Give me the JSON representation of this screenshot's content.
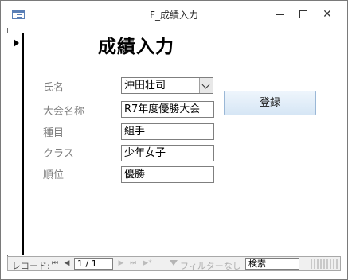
{
  "window": {
    "title": "F_成績入力",
    "minimize_glyph": "",
    "close_glyph": "✕"
  },
  "form": {
    "title": "成績入力",
    "fields": [
      {
        "label": "氏名",
        "value": "沖田壮司",
        "type": "combo"
      },
      {
        "label": "大会名称",
        "value": "R7年度優勝大会",
        "type": "text"
      },
      {
        "label": "種目",
        "value": "組手",
        "type": "text"
      },
      {
        "label": "クラス",
        "value": "少年女子",
        "type": "text"
      },
      {
        "label": "順位",
        "value": "優勝",
        "type": "text"
      }
    ],
    "register_button": "登録"
  },
  "navbar": {
    "record_label": "レコード:",
    "first_glyph": "⏮",
    "prev_glyph": "◀",
    "record_position": "1 / 1",
    "next_glyph": "▶",
    "last_glyph": "⏭",
    "new_glyph": "▶*",
    "filter_label": "フィルターなし",
    "search_label": "検索"
  },
  "colors": {
    "accent": "#d6e6f5",
    "label_gray": "#7f7f7f"
  }
}
